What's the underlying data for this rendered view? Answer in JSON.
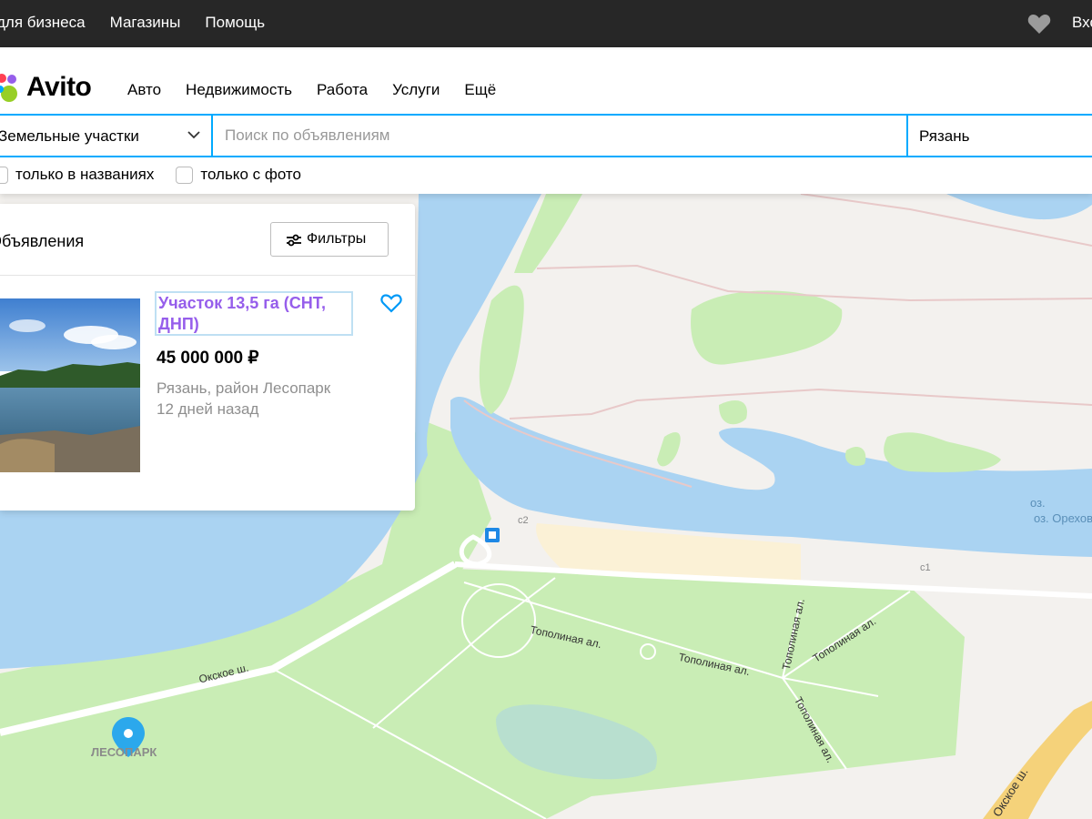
{
  "topbar": {
    "links": [
      "для бизнеса",
      "Магазины",
      "Помощь"
    ],
    "login": "Вход",
    "favorites_icon": "heart-icon"
  },
  "header": {
    "logo": "Avito",
    "nav": [
      "Авто",
      "Недвижимость",
      "Работа",
      "Услуги",
      "Ещё"
    ],
    "category": "Земельные участки",
    "search_placeholder": "Поиск по объявлениям",
    "city": "Рязань",
    "checkbox_titles": "только в названиях",
    "checkbox_photo": "только с фото"
  },
  "listing_panel": {
    "title": "Объявления",
    "filters_label": "Фильтры",
    "item": {
      "title": "Участок 13,5 га (СНТ, ДНП)",
      "price": "45 000 000 ₽",
      "location": "Рязань, район Лесопарк",
      "date": "12 дней назад"
    }
  },
  "map": {
    "labels": {
      "lake": "оз. Ореховое",
      "c2": "с2",
      "c1": "с1",
      "road_okskoe": "Окское ш.",
      "road_okskoe2": "Окское ш.",
      "topolinaya1": "Тополиная ал.",
      "topolinaya2": "Тополиная ал.",
      "topolinaya3": "Тополиная ал.",
      "topolinaya4": "Тополиная ал.",
      "topolinaya5": "Тополиная ал.",
      "district": "ЛЕСОПАРК"
    }
  },
  "colors": {
    "accent": "#00aaff",
    "link_visited": "#965eeb",
    "water": "#aad3f2",
    "park": "#c9edb5",
    "topbar": "#272727"
  }
}
